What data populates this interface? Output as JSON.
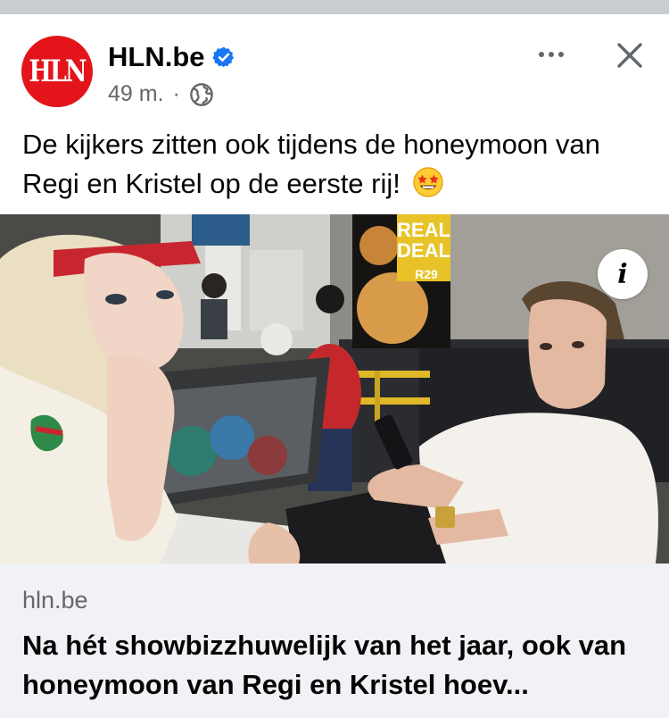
{
  "post": {
    "avatar_text": "HLN",
    "page_name": "HLN.be",
    "time": "49 m.",
    "separator": "·",
    "text": "De kijkers zitten ook tijdens de honeymoon van Regi en Kristel op de eerste rij!",
    "emoji": "star-struck-emoji"
  },
  "photo": {
    "sign_line1": "REAL",
    "sign_line2": "DEAL",
    "sign_price": "R29",
    "info_label": "i"
  },
  "link_preview": {
    "domain": "hln.be",
    "title": "Na hét showbizzhuwelijk van het jaar, ook van honeymoon van Regi en Kristel hoev..."
  },
  "colors": {
    "brand_red": "#e3151b",
    "verified_blue": "#1877f2",
    "meta_gray": "#65676b",
    "card_bg": "#f0f2f5"
  }
}
